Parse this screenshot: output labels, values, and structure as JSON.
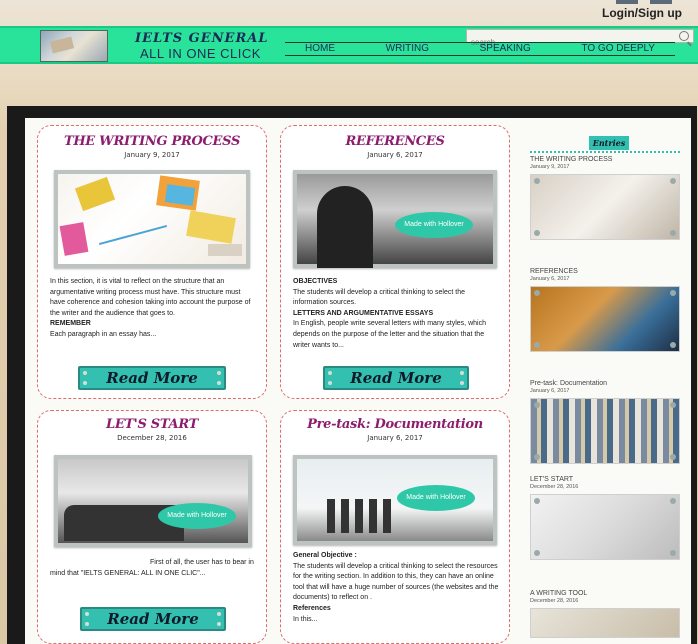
{
  "header": {
    "login_label": "Login/Sign up",
    "brand_title": "IELTS GENERAL",
    "brand_subtitle": "ALL IN ONE CLICK",
    "search_placeholder": "search",
    "nav": [
      "HOME",
      "WRITING",
      "SPEAKING",
      "TO GO DEEPLY"
    ],
    "accent_color": "#29e39a"
  },
  "posts": [
    {
      "title": "THE WRITING PROCESS",
      "date": "January 9, 2017",
      "excerpt": "In this section, it is vital to reflect on the structure that an argumentative writing process must have. This structure must have coherence and cohesion taking into account the purpose of the writer and the audience that goes to.",
      "excerpt_bold": "REMEMBER",
      "excerpt_tail": "Each paragraph in an essay has...",
      "button": "Read More"
    },
    {
      "title": "REFERENCES",
      "date": "January 6, 2017",
      "image_badge": "Made with Hollover",
      "excerpt_bold": "OBJECTIVES",
      "excerpt": "The students will develop a critical thinking to select the information sources.",
      "excerpt_bold2": "LETTERS AND ARGUMENTATIVE ESSAYS",
      "excerpt_tail": "In English, people write several letters with many styles, which depends on the purpose of the letter and the situation that the writer wants to...",
      "button": "Read More"
    },
    {
      "title": "LET'S START",
      "date": "December 28, 2016",
      "image_badge": "Made with Hollover",
      "excerpt": "First of all, the user has to bear in mind that \"IELTS GENERAL: ALL IN ONE CLIC\"...",
      "button": "Read More"
    },
    {
      "title": "Pre-task: Documentation",
      "date": "January 6, 2017",
      "image_badge": "Made with Hollover",
      "excerpt_bold": "General Objective :",
      "excerpt": "The students will develop a critical thinking to select the resources for the writing section. In addition to this, they can have an online tool that will have a huge number of sources (the websites and the documents) to reflect on .",
      "excerpt_bold2": "References",
      "excerpt_tail": "In this..."
    }
  ],
  "sidebar": {
    "title": "Entries",
    "entries": [
      {
        "title": "THE WRITING PROCESS",
        "date": "January 9, 2017"
      },
      {
        "title": "REFERENCES",
        "date": "January 6, 2017"
      },
      {
        "title": "Pre-task: Documentation",
        "date": "January 6, 2017"
      },
      {
        "title": "LET'S START",
        "date": "December 28, 2016"
      },
      {
        "title": "A WRITING TOOL",
        "date": "December 28, 2016"
      }
    ]
  }
}
